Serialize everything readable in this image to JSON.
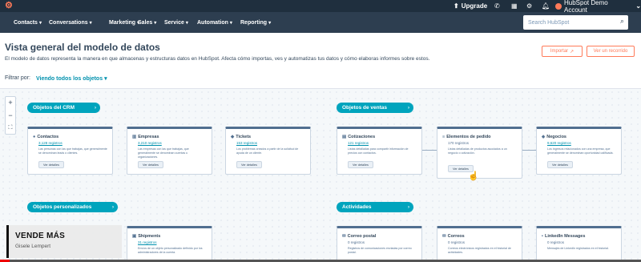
{
  "top_bar": {
    "upgrade_label": "Upgrade",
    "account_name": "HubSpot Demo Account"
  },
  "nav": {
    "items": [
      {
        "label": "Contacts"
      },
      {
        "label": "Conversations"
      },
      {
        "label": "Marketing"
      },
      {
        "label": "Sales"
      },
      {
        "label": "Service"
      },
      {
        "label": "Automation"
      },
      {
        "label": "Reporting"
      }
    ],
    "search_placeholder": "Search HubSpot"
  },
  "header": {
    "title": "Vista general del modelo de datos",
    "description": "El modelo de datos representa la manera en que almacenas y estructuras datos en HubSpot. Afecta cómo importas, ves y automatizas tus datos y cómo elaboras informes sobre estos.",
    "import_label": "Importar",
    "recorrido_label": "Ver un recorrido",
    "filter_label": "Filtrar por:",
    "filter_value": "Viendo todos los objetos"
  },
  "zoom": {
    "in": "+",
    "out": "−",
    "fit": "⛶"
  },
  "groups": {
    "crm": "Objetos del CRM",
    "ventas": "Objetos de ventas",
    "personalizados": "Objetos personalizados",
    "actividades": "Actividades"
  },
  "cards": {
    "contactos": {
      "title": "Contactos",
      "count": "3,128 registros",
      "desc": "Las personas con las que trabajas, que generalmente se denominan leads o clientes.",
      "button": "Ver detalles"
    },
    "empresas": {
      "title": "Empresas",
      "count": "3,210 registros",
      "desc": "Las empresas con las que trabajas, que generalmente se denominan cuentas u organizaciones.",
      "button": "Ver detalles"
    },
    "tickets": {
      "title": "Tickets",
      "count": "153 registros",
      "desc": "Los problemas creados a partir de la solicitud de ayuda de un cliente.",
      "button": "Ver detalles"
    },
    "cotizaciones": {
      "title": "Cotizaciones",
      "count": "121 registros",
      "desc": "Listas detalladas para compartir información de precios con contactos.",
      "button": "Ver detalles"
    },
    "elementos": {
      "title": "Elementos de pedido",
      "count": "170 registros",
      "desc": "Listas detalladas de productos asociados a un negocio o cotización.",
      "button": "Ver detalles"
    },
    "negocios": {
      "title": "Negocios",
      "count": "9,620 registros",
      "desc": "Los ingresos relacionados con una empresa, que generalmente se denominan oportunidad calificada.",
      "button": "Ver detalles"
    },
    "shipments": {
      "title": "Shipments",
      "count": "31 registros",
      "desc": "Envíos de un objeto personalizado definido por los administradores de la cuenta.",
      "button": "Ver detalles"
    },
    "correo_postal": {
      "title": "Correo postal",
      "count": "0 registros",
      "desc": "Registros de comunicaciones enviadas por correo postal.",
      "button": "Ver detalles"
    },
    "correos": {
      "title": "Correos",
      "count": "0 registros",
      "desc": "Correos electrónicos registrados en el historial de actividades.",
      "button": "Ver detalles"
    },
    "linkedin": {
      "title": "LinkedIn Messages",
      "count": "0 registros",
      "desc": "Mensajes de LinkedIn registrados en el historial.",
      "button": "Ver detalles"
    }
  },
  "overlay": {
    "title": "VENDE MÁS",
    "subtitle": "Gisele Lempert"
  }
}
